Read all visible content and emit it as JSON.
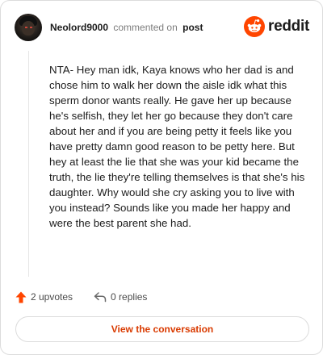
{
  "header": {
    "username": "Neolord9000",
    "action": "commented on",
    "target": "post",
    "brand": "reddit",
    "brand_color": "#ff4500",
    "avatar_icon": "user-avatar",
    "brand_icon": "reddit-snoo-icon"
  },
  "comment": {
    "text": "NTA- Hey man idk, Kaya knows who her dad is and chose him to walk her down the aisle idk what this sperm donor wants really. He gave her up because he's selfish, they let her go because they don't care about her and if you are being petty it feels like you have pretty damn good reason to be petty here. But hey at least the lie that she was your kid became the truth, the lie they're telling themselves is that she's his daughter. Why would she cry asking you to live with you instead? Sounds like you made her happy and were the best parent she had."
  },
  "footer": {
    "upvotes_label": "2 upvotes",
    "replies_label": "0 replies",
    "upvote_icon": "upvote-arrow-icon",
    "reply_icon": "reply-arrow-icon",
    "upvote_color": "#ff4500"
  },
  "cta": {
    "label": "View the conversation",
    "color": "#d93a00"
  }
}
